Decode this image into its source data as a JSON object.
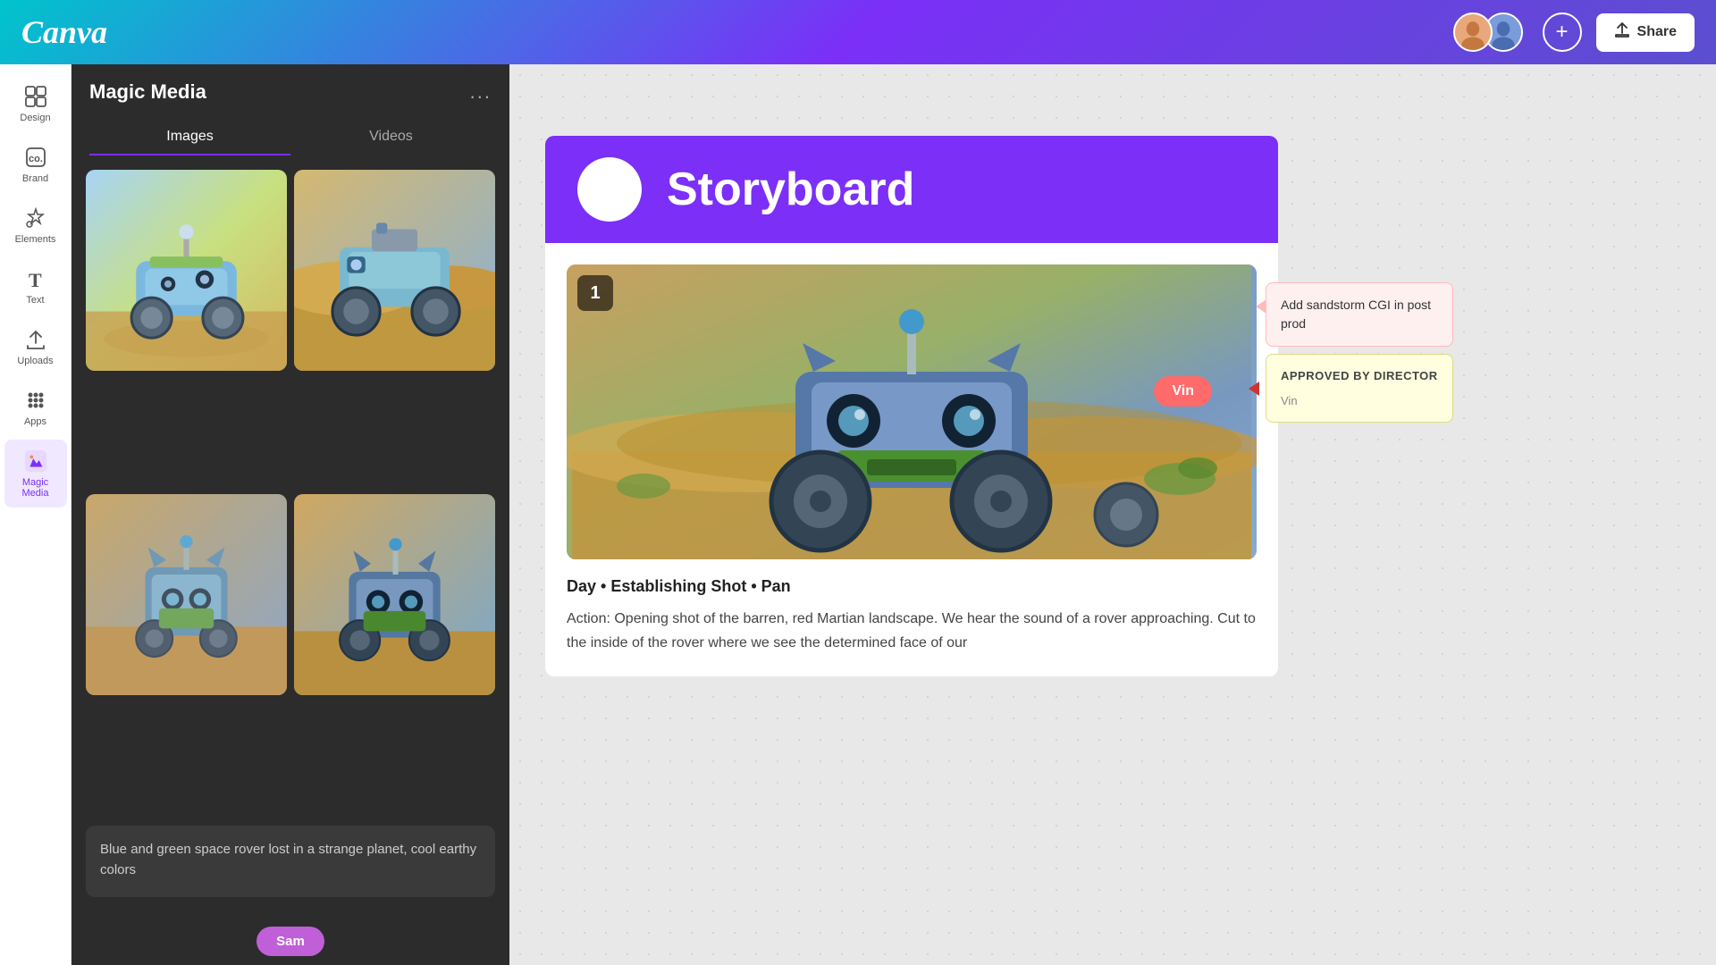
{
  "header": {
    "logo": "Canva",
    "share_button_label": "Share",
    "share_icon": "↑",
    "add_collaborator_icon": "+"
  },
  "sidebar": {
    "items": [
      {
        "id": "design",
        "label": "Design",
        "icon": "⊞"
      },
      {
        "id": "brand",
        "label": "Brand",
        "icon": "©"
      },
      {
        "id": "elements",
        "label": "Elements",
        "icon": "♡△"
      },
      {
        "id": "text",
        "label": "Text",
        "icon": "T"
      },
      {
        "id": "uploads",
        "label": "Uploads",
        "icon": "↑"
      },
      {
        "id": "apps",
        "label": "Apps",
        "icon": "⋮⋮"
      },
      {
        "id": "magic-media",
        "label": "Magic Media",
        "icon": "🪄",
        "active": true
      }
    ]
  },
  "panel": {
    "title": "Magic Media",
    "more_icon": "...",
    "tabs": [
      {
        "id": "images",
        "label": "Images",
        "active": true
      },
      {
        "id": "videos",
        "label": "Videos",
        "active": false
      }
    ],
    "images": [
      {
        "id": 1,
        "alt": "Blue space rover in alien landscape"
      },
      {
        "id": 2,
        "alt": "Space rover on sand dunes"
      },
      {
        "id": 3,
        "alt": "Green robot rover on planet"
      },
      {
        "id": 4,
        "alt": "Blue-green robot rover"
      }
    ],
    "prompt_placeholder": "Blue and green space rover lost in a strange planet, cool earthy colors",
    "prompt_value": "Blue and green space rover lost in a strange planet, cool earthy colors",
    "sam_label": "Sam"
  },
  "canvas": {
    "storyboard": {
      "title": "Storyboard",
      "logo_alt": "Company logo",
      "shot_number": "1",
      "shot_info": "Day • Establishing Shot • Pan",
      "description": "Action: Opening shot of the barren, red Martian landscape. We hear the sound of a rover approaching. Cut to the inside of the rover where we see the determined face of our",
      "vin_badge": "Vin",
      "annotation_sandstorm": "Add sandstorm CGI in post prod",
      "annotation_approved_title": "APPROVED BY DIRECTOR",
      "annotation_vin_name": "Vin"
    }
  }
}
